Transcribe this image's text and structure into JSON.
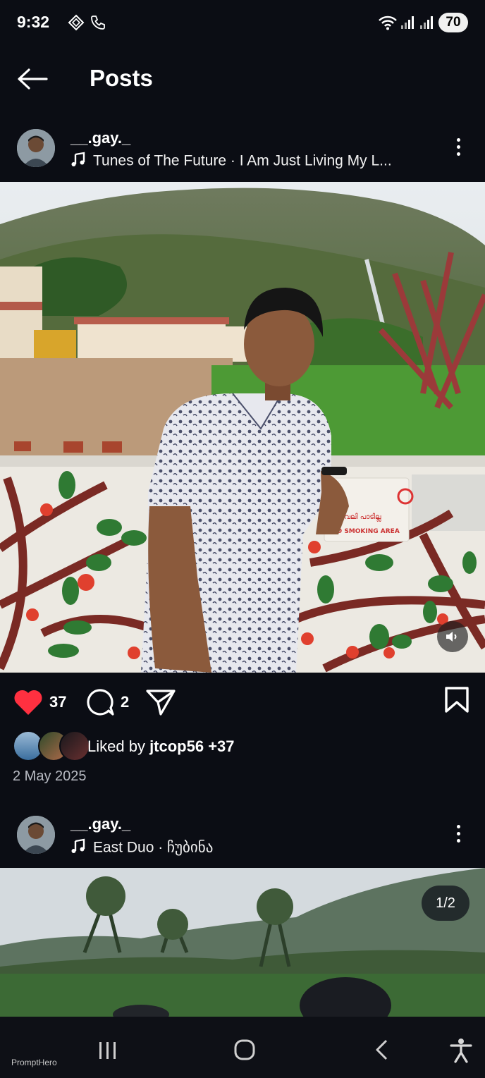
{
  "status_bar": {
    "time": "9:32",
    "battery": "70"
  },
  "header": {
    "title": "Posts"
  },
  "post1": {
    "username": "__.gay._",
    "song": "Tunes of The Future · I Am Just Living My L...",
    "likes_count": "37",
    "comments_count": "2",
    "liked_by_prefix": "Liked by ",
    "liked_by_user": "jtcop56",
    "liked_by_suffix": " +37",
    "date": "2 May 2025",
    "sign_text_1": "പുകവലി പാടില്ല",
    "sign_text_2": "NO SMOKING AREA"
  },
  "post2": {
    "username": "__.gay._",
    "song": "East Duo · ჩუბინა",
    "pager": "1/2"
  },
  "watermark": "PromptHero",
  "colors": {
    "background": "#0b0d14",
    "like_red": "#ff3040",
    "text": "#ffffff"
  }
}
